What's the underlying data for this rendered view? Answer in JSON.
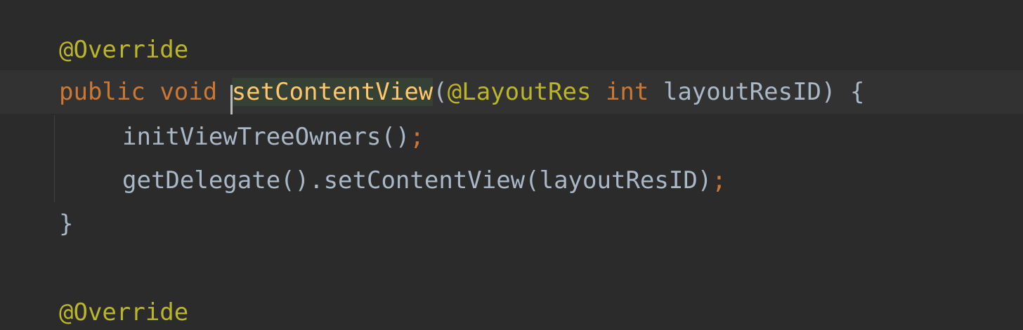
{
  "colors": {
    "background": "#2b2b2b",
    "current_line": "#323232",
    "annotation": "#bbb529",
    "keyword": "#cc7832",
    "method_declaration": "#ffc66d",
    "default_text": "#a9b7c6",
    "identifier_highlight": "#344134"
  },
  "code": {
    "line1": {
      "annotation": "@Override"
    },
    "line2": {
      "kw_public": "public",
      "kw_void": "void",
      "method_name": "setContentView",
      "open_paren": "(",
      "param_annotation": "@LayoutRes",
      "kw_int": "int",
      "param_rest": "layoutResID) {"
    },
    "line3": {
      "call": "initViewTreeOwners()",
      "semicolon": ";"
    },
    "line4": {
      "call": "getDelegate().setContentView(layoutResID)",
      "semicolon": ";"
    },
    "line5": {
      "text": "}"
    },
    "line7": {
      "annotation": "@Override"
    }
  }
}
